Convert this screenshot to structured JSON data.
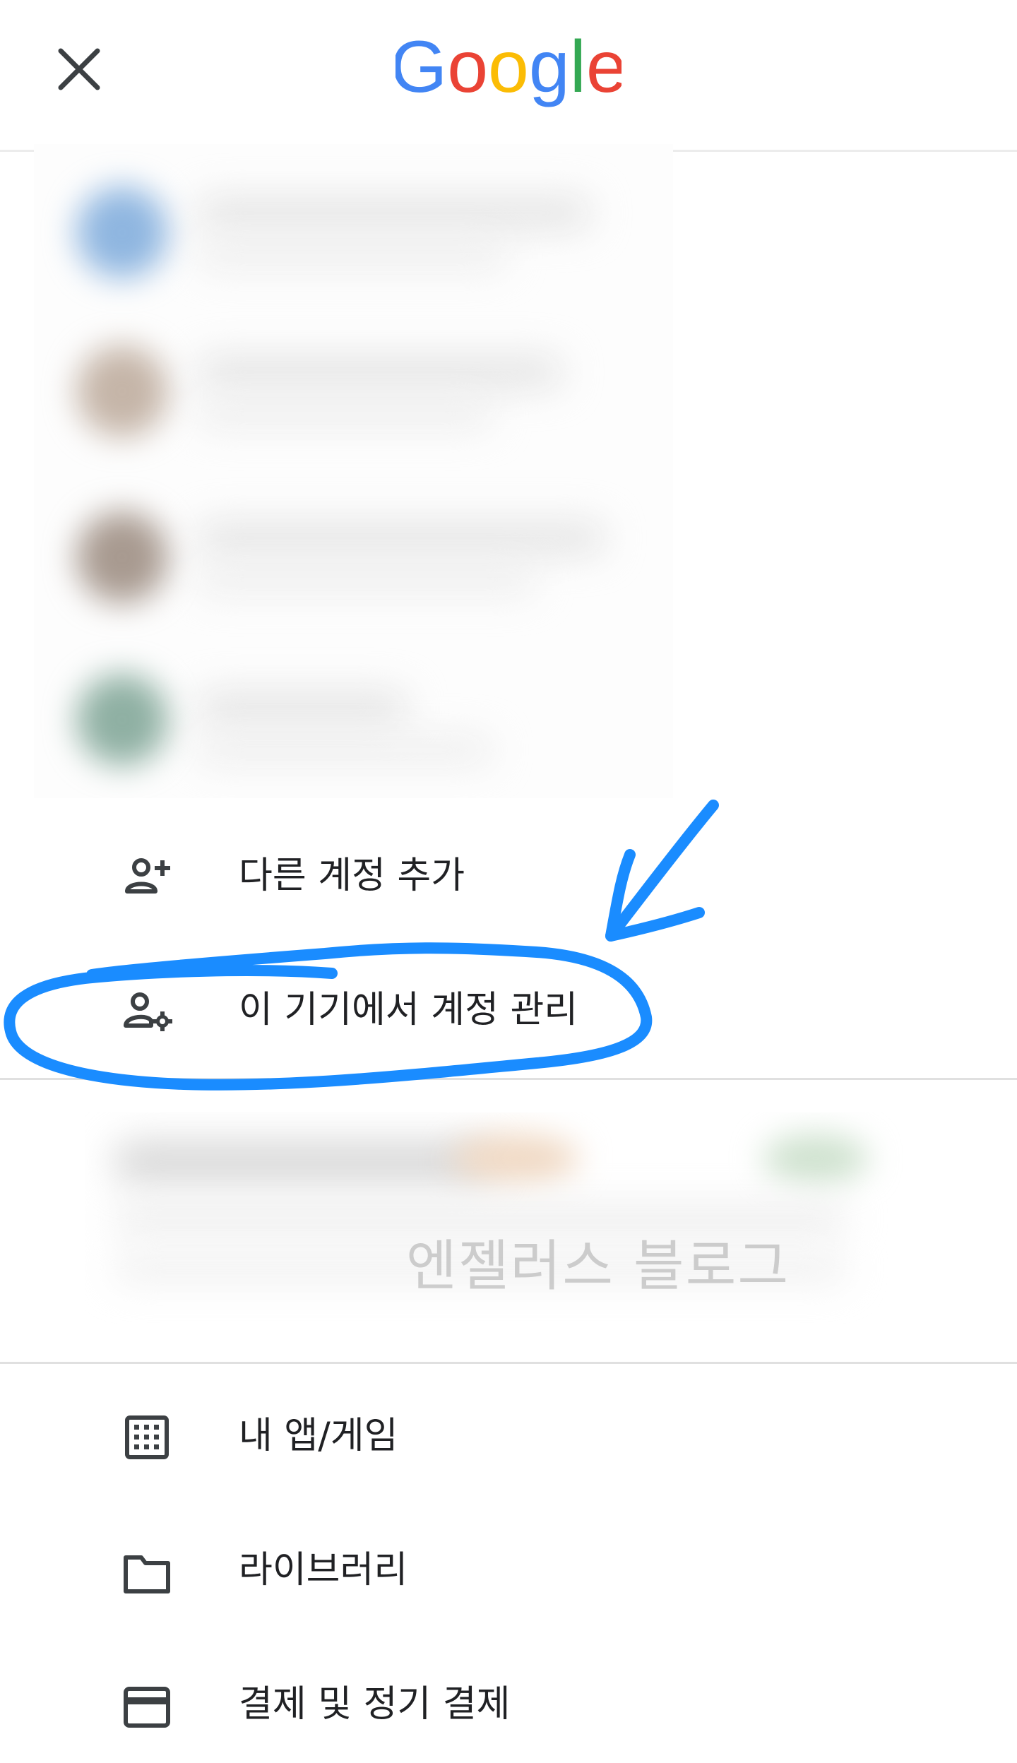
{
  "header": {
    "logo_text": "Google",
    "logo_letters": [
      {
        "char": "G",
        "color": "#4285F4"
      },
      {
        "char": "o",
        "color": "#EA4335"
      },
      {
        "char": "o",
        "color": "#FBBC05"
      },
      {
        "char": "g",
        "color": "#4285F4"
      },
      {
        "char": "l",
        "color": "#34A853"
      },
      {
        "char": "e",
        "color": "#EA4335"
      }
    ],
    "close_icon": "close-icon"
  },
  "account_menu": {
    "items": [
      {
        "label": "다른 계정 추가",
        "icon": "person-add-icon"
      },
      {
        "label": "이 기기에서 계정 관리",
        "icon": "manage-accounts-icon"
      }
    ]
  },
  "watermark_text": "엔젤러스 블로그",
  "main_menu": {
    "items": [
      {
        "label": "내 앱/게임",
        "icon": "apps-grid-icon"
      },
      {
        "label": "라이브러리",
        "icon": "folder-icon"
      },
      {
        "label": "결제 및 정기 결제",
        "icon": "credit-card-icon"
      }
    ]
  },
  "annotation_color": "#1a8cff"
}
